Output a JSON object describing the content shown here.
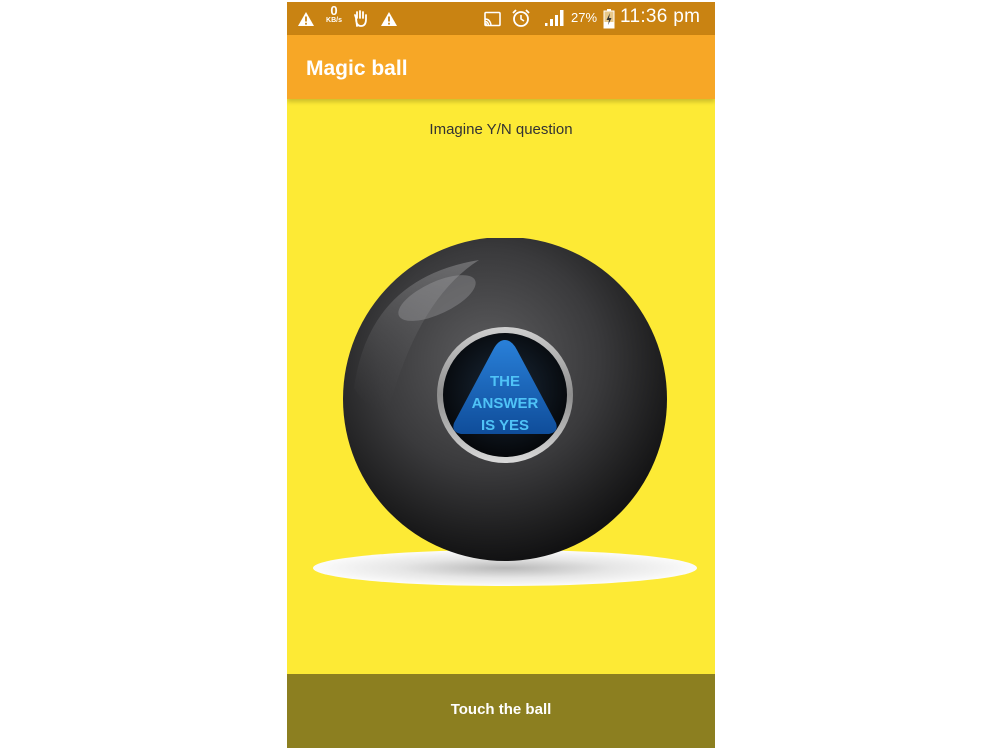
{
  "status_bar": {
    "network_speed_value": "0",
    "network_speed_unit": "KB/s",
    "battery_percent": "27%",
    "time": "11:36 pm",
    "icons": [
      "warning-icon",
      "hand-icon",
      "warning-icon",
      "cast-icon",
      "alarm-icon",
      "signal-icon",
      "battery-icon"
    ]
  },
  "app_bar": {
    "title": "Magic ball"
  },
  "main": {
    "prompt": "Imagine Y/N question",
    "ball": {
      "answer_line1": "THE",
      "answer_line2": "ANSWER",
      "answer_line3": "IS YES"
    }
  },
  "footer": {
    "button_label": "Touch the ball"
  },
  "colors": {
    "status_bar": "#c98312",
    "app_bar": "#f7a726",
    "background": "#fdea35",
    "footer": "#8c7f20",
    "answer_triangle": "#1b6fc2",
    "answer_text": "#4fc3f7"
  }
}
